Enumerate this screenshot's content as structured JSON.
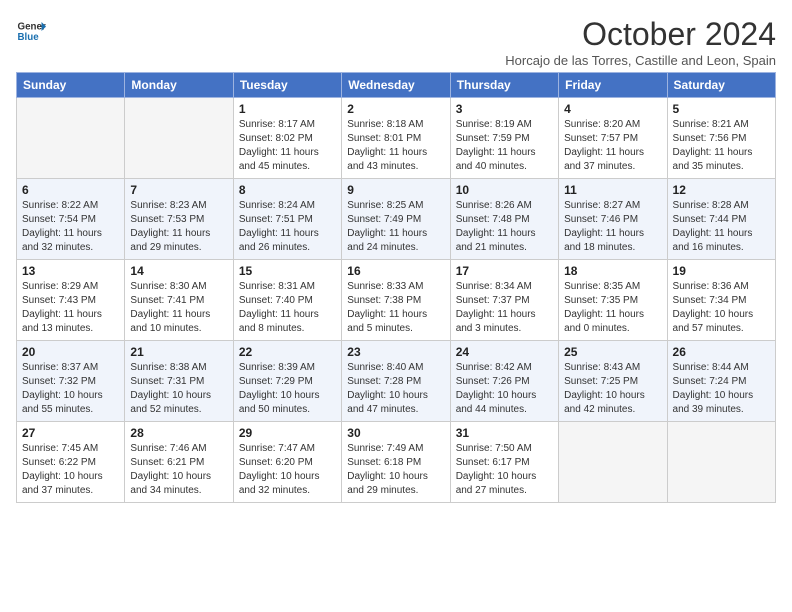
{
  "logo": {
    "line1": "General",
    "line2": "Blue"
  },
  "title": "October 2024",
  "subtitle": "Horcajo de las Torres, Castille and Leon, Spain",
  "days_of_week": [
    "Sunday",
    "Monday",
    "Tuesday",
    "Wednesday",
    "Thursday",
    "Friday",
    "Saturday"
  ],
  "weeks": [
    [
      {
        "day": "",
        "info": ""
      },
      {
        "day": "",
        "info": ""
      },
      {
        "day": "1",
        "info": "Sunrise: 8:17 AM\nSunset: 8:02 PM\nDaylight: 11 hours and 45 minutes."
      },
      {
        "day": "2",
        "info": "Sunrise: 8:18 AM\nSunset: 8:01 PM\nDaylight: 11 hours and 43 minutes."
      },
      {
        "day": "3",
        "info": "Sunrise: 8:19 AM\nSunset: 7:59 PM\nDaylight: 11 hours and 40 minutes."
      },
      {
        "day": "4",
        "info": "Sunrise: 8:20 AM\nSunset: 7:57 PM\nDaylight: 11 hours and 37 minutes."
      },
      {
        "day": "5",
        "info": "Sunrise: 8:21 AM\nSunset: 7:56 PM\nDaylight: 11 hours and 35 minutes."
      }
    ],
    [
      {
        "day": "6",
        "info": "Sunrise: 8:22 AM\nSunset: 7:54 PM\nDaylight: 11 hours and 32 minutes."
      },
      {
        "day": "7",
        "info": "Sunrise: 8:23 AM\nSunset: 7:53 PM\nDaylight: 11 hours and 29 minutes."
      },
      {
        "day": "8",
        "info": "Sunrise: 8:24 AM\nSunset: 7:51 PM\nDaylight: 11 hours and 26 minutes."
      },
      {
        "day": "9",
        "info": "Sunrise: 8:25 AM\nSunset: 7:49 PM\nDaylight: 11 hours and 24 minutes."
      },
      {
        "day": "10",
        "info": "Sunrise: 8:26 AM\nSunset: 7:48 PM\nDaylight: 11 hours and 21 minutes."
      },
      {
        "day": "11",
        "info": "Sunrise: 8:27 AM\nSunset: 7:46 PM\nDaylight: 11 hours and 18 minutes."
      },
      {
        "day": "12",
        "info": "Sunrise: 8:28 AM\nSunset: 7:44 PM\nDaylight: 11 hours and 16 minutes."
      }
    ],
    [
      {
        "day": "13",
        "info": "Sunrise: 8:29 AM\nSunset: 7:43 PM\nDaylight: 11 hours and 13 minutes."
      },
      {
        "day": "14",
        "info": "Sunrise: 8:30 AM\nSunset: 7:41 PM\nDaylight: 11 hours and 10 minutes."
      },
      {
        "day": "15",
        "info": "Sunrise: 8:31 AM\nSunset: 7:40 PM\nDaylight: 11 hours and 8 minutes."
      },
      {
        "day": "16",
        "info": "Sunrise: 8:33 AM\nSunset: 7:38 PM\nDaylight: 11 hours and 5 minutes."
      },
      {
        "day": "17",
        "info": "Sunrise: 8:34 AM\nSunset: 7:37 PM\nDaylight: 11 hours and 3 minutes."
      },
      {
        "day": "18",
        "info": "Sunrise: 8:35 AM\nSunset: 7:35 PM\nDaylight: 11 hours and 0 minutes."
      },
      {
        "day": "19",
        "info": "Sunrise: 8:36 AM\nSunset: 7:34 PM\nDaylight: 10 hours and 57 minutes."
      }
    ],
    [
      {
        "day": "20",
        "info": "Sunrise: 8:37 AM\nSunset: 7:32 PM\nDaylight: 10 hours and 55 minutes."
      },
      {
        "day": "21",
        "info": "Sunrise: 8:38 AM\nSunset: 7:31 PM\nDaylight: 10 hours and 52 minutes."
      },
      {
        "day": "22",
        "info": "Sunrise: 8:39 AM\nSunset: 7:29 PM\nDaylight: 10 hours and 50 minutes."
      },
      {
        "day": "23",
        "info": "Sunrise: 8:40 AM\nSunset: 7:28 PM\nDaylight: 10 hours and 47 minutes."
      },
      {
        "day": "24",
        "info": "Sunrise: 8:42 AM\nSunset: 7:26 PM\nDaylight: 10 hours and 44 minutes."
      },
      {
        "day": "25",
        "info": "Sunrise: 8:43 AM\nSunset: 7:25 PM\nDaylight: 10 hours and 42 minutes."
      },
      {
        "day": "26",
        "info": "Sunrise: 8:44 AM\nSunset: 7:24 PM\nDaylight: 10 hours and 39 minutes."
      }
    ],
    [
      {
        "day": "27",
        "info": "Sunrise: 7:45 AM\nSunset: 6:22 PM\nDaylight: 10 hours and 37 minutes."
      },
      {
        "day": "28",
        "info": "Sunrise: 7:46 AM\nSunset: 6:21 PM\nDaylight: 10 hours and 34 minutes."
      },
      {
        "day": "29",
        "info": "Sunrise: 7:47 AM\nSunset: 6:20 PM\nDaylight: 10 hours and 32 minutes."
      },
      {
        "day": "30",
        "info": "Sunrise: 7:49 AM\nSunset: 6:18 PM\nDaylight: 10 hours and 29 minutes."
      },
      {
        "day": "31",
        "info": "Sunrise: 7:50 AM\nSunset: 6:17 PM\nDaylight: 10 hours and 27 minutes."
      },
      {
        "day": "",
        "info": ""
      },
      {
        "day": "",
        "info": ""
      }
    ]
  ]
}
